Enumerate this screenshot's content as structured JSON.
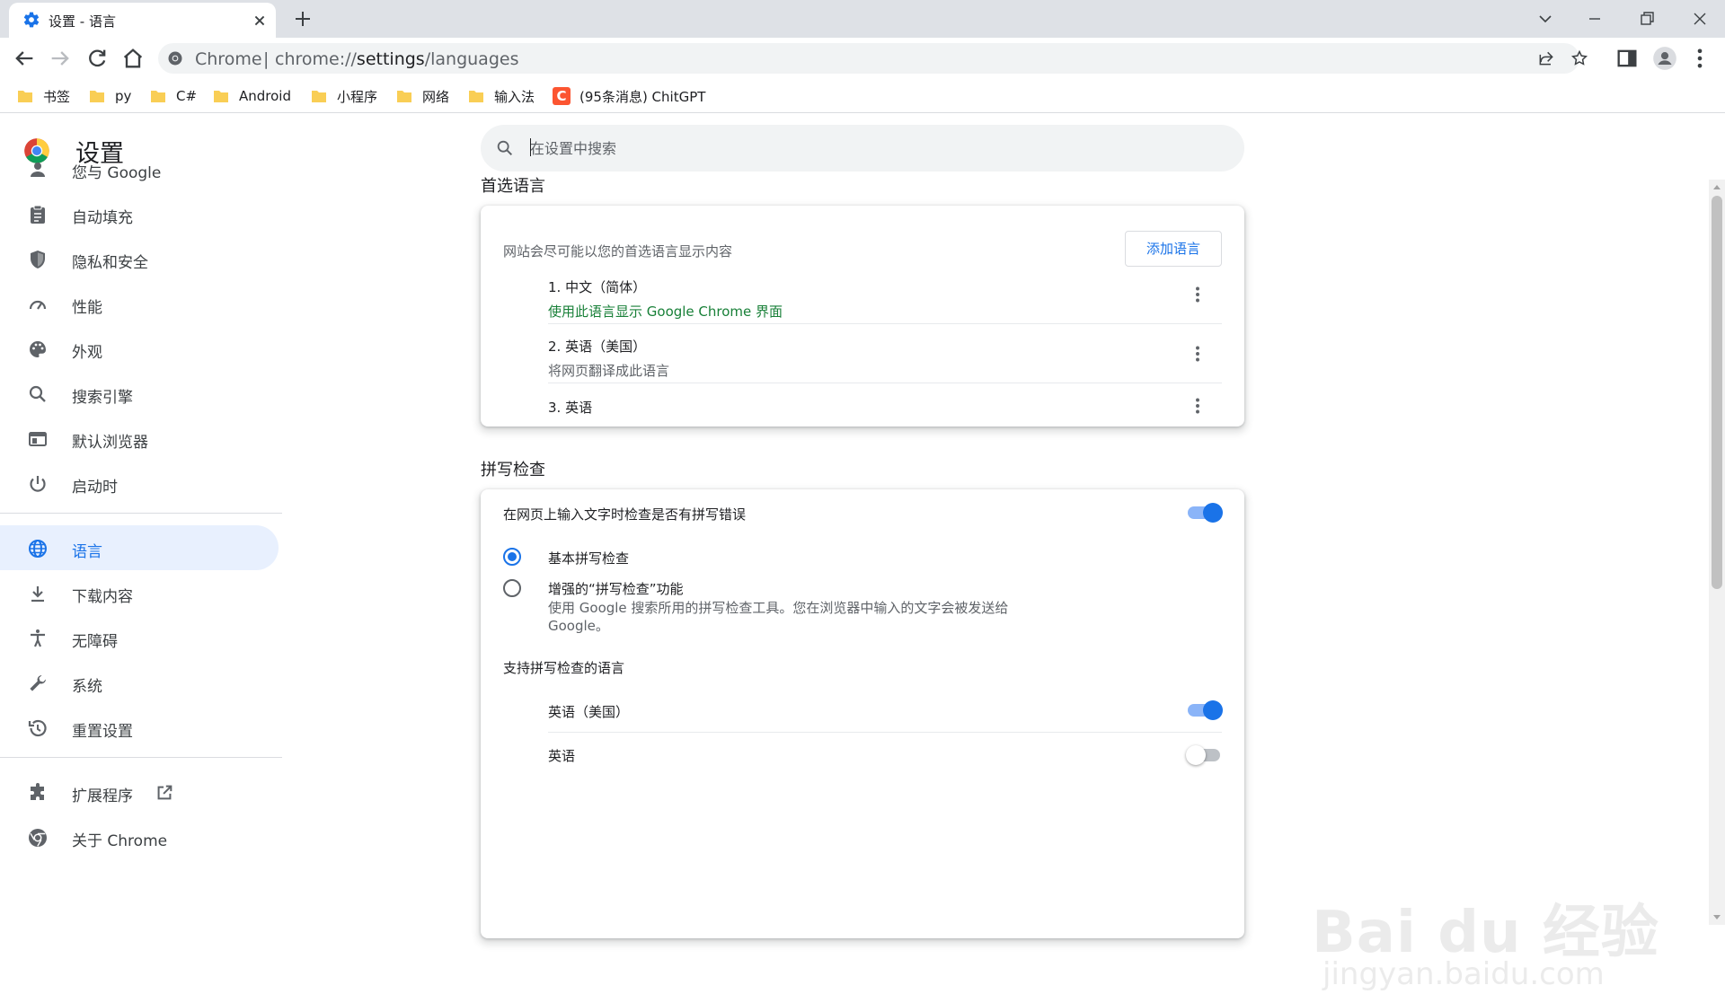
{
  "tab": {
    "title": "设置 - 语言"
  },
  "address": {
    "site": "Chrome",
    "separator": "|",
    "url_prefix": "chrome://",
    "url_host": "settings",
    "url_path": "/languages"
  },
  "bookmarks": [
    {
      "label": "书签",
      "icon": "folder-icon"
    },
    {
      "label": "py",
      "icon": "folder-icon"
    },
    {
      "label": "C#",
      "icon": "folder-icon"
    },
    {
      "label": "Android",
      "icon": "folder-icon"
    },
    {
      "label": "小程序",
      "icon": "folder-icon"
    },
    {
      "label": "网络",
      "icon": "folder-icon"
    },
    {
      "label": "输入法",
      "icon": "folder-icon"
    },
    {
      "label": "(95条消息) ChitGPT",
      "icon": "csdn-icon",
      "icon_text": "C"
    }
  ],
  "page": {
    "title": "设置"
  },
  "sidebar": {
    "items": [
      {
        "label": "您与 Google",
        "icon": "person-icon"
      },
      {
        "label": "自动填充",
        "icon": "clipboard-icon"
      },
      {
        "label": "隐私和安全",
        "icon": "shield-icon"
      },
      {
        "label": "性能",
        "icon": "speedometer-icon"
      },
      {
        "label": "外观",
        "icon": "palette-icon"
      },
      {
        "label": "搜索引擎",
        "icon": "search-icon"
      },
      {
        "label": "默认浏览器",
        "icon": "browser-window-icon"
      },
      {
        "label": "启动时",
        "icon": "power-icon"
      },
      {
        "label": "语言",
        "icon": "globe-icon",
        "active": true
      },
      {
        "label": "下载内容",
        "icon": "download-icon"
      },
      {
        "label": "无障碍",
        "icon": "accessibility-icon"
      },
      {
        "label": "系统",
        "icon": "wrench-icon"
      },
      {
        "label": "重置设置",
        "icon": "history-icon"
      },
      {
        "label": "扩展程序",
        "icon": "puzzle-icon"
      },
      {
        "label": "关于 Chrome",
        "icon": "chrome-icon"
      }
    ]
  },
  "search": {
    "placeholder": "在设置中搜索"
  },
  "preferred": {
    "title": "首选语言",
    "description": "网站会尽可能以您的首选语言显示内容",
    "add_button": "添加语言",
    "languages": [
      {
        "name": "1. 中文（简体）",
        "sub": "使用此语言显示 Google Chrome 界面"
      },
      {
        "name": "2. 英语（美国）",
        "sub": "将网页翻译成此语言"
      },
      {
        "name": "3. 英语",
        "sub": ""
      }
    ]
  },
  "spellcheck": {
    "title": "拼写检查",
    "toggle_label": "在网页上输入文字时检查是否有拼写错误",
    "toggle_on": true,
    "basic_label": "基本拼写检查",
    "basic_checked": true,
    "enhanced_label": "增强的“拼写检查”功能",
    "enhanced_desc_1": "使用 Google 搜索所用的拼写检查工具。您在浏览器中输入的文字会被发送给",
    "enhanced_desc_2": "Google。",
    "languages_title": "支持拼写检查的语言",
    "languages": [
      {
        "name": "英语（美国）",
        "on": true
      },
      {
        "name": "英语",
        "on": false
      }
    ]
  },
  "watermark": {
    "brand": "Bai du 经验",
    "site": "jingyan.baidu.com"
  },
  "colors": {
    "accent": "#1a73e8",
    "active_bg": "#e8f0fe",
    "green": "#188038",
    "tabstrip": "#dee1e6"
  }
}
